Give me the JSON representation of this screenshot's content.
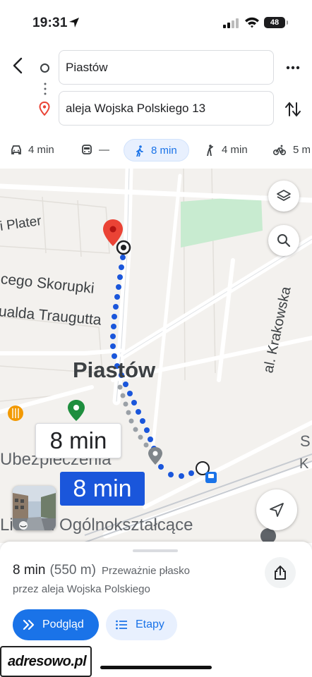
{
  "status_bar": {
    "time": "19:31",
    "battery": "48"
  },
  "route": {
    "origin": "Piastów",
    "destination": "aleja Wojska Polskiego 13"
  },
  "modes": [
    {
      "name": "car",
      "value": "4 min",
      "icon": "car-icon"
    },
    {
      "name": "transit",
      "value": "—",
      "icon": "transit-icon"
    },
    {
      "name": "walk",
      "value": "8 min",
      "icon": "walk-icon",
      "selected": true
    },
    {
      "name": "ride",
      "value": "4 min",
      "icon": "ride-hail-icon"
    },
    {
      "name": "bike",
      "value": "5 m",
      "icon": "bike-icon"
    }
  ],
  "map": {
    "labels": {
      "plater": "i Plater",
      "skorupki": "cego Skorupki",
      "traugutta": "ualda Traugutta",
      "town": "Piastów",
      "krakowska": "al. Krakowska",
      "ubezpieczenia": "Ubezpieczenia",
      "liceum": "Liceum Ogólnokształcące",
      "edge_s": "S",
      "edge_k": "K"
    },
    "route_time_alt": "8 min",
    "route_time_selected": "8 min",
    "route_color": "#1a56db",
    "destination_pin_color": "#ea4335"
  },
  "sheet": {
    "time": "8 min",
    "distance": "(550 m)",
    "terrain": "Przeważnie płasko",
    "via": "przez aleja Wojska Polskiego",
    "preview_label": "Podgląd",
    "steps_label": "Etapy",
    "accent": "#1a73e8"
  },
  "watermark": "adresowo.pl"
}
